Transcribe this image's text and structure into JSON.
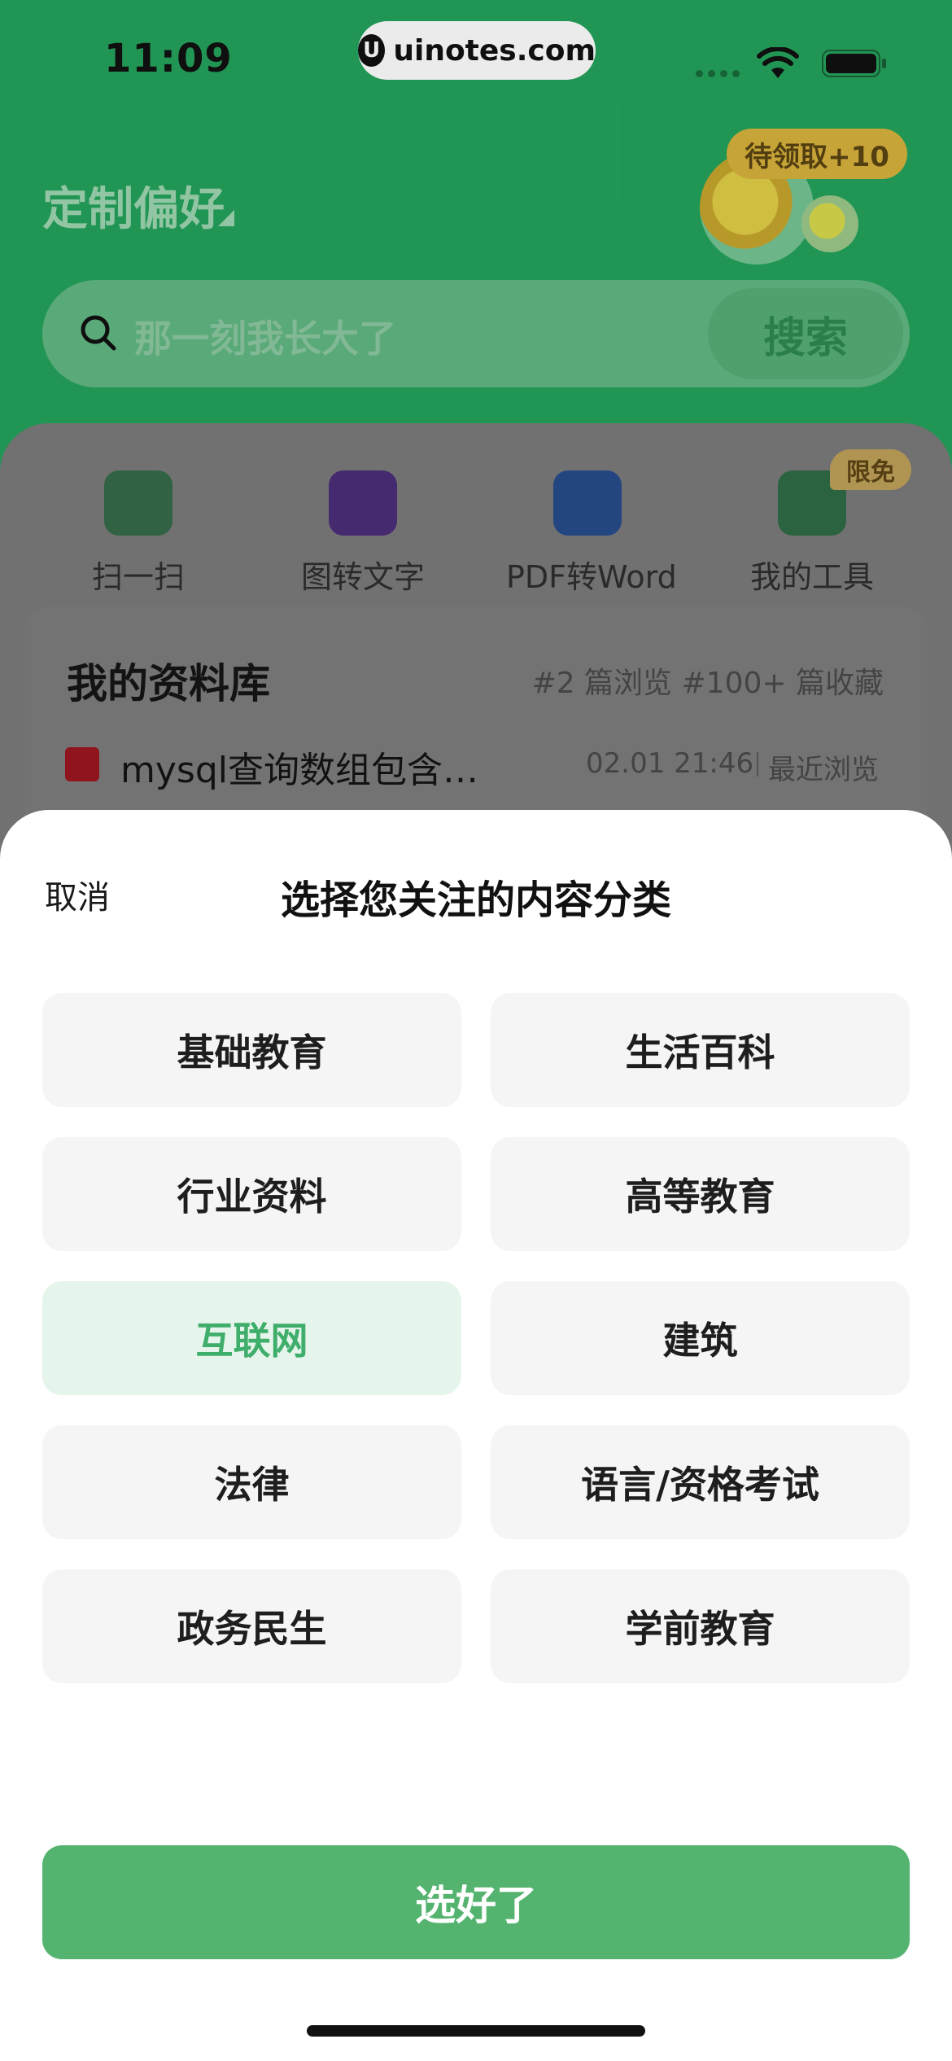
{
  "status_bar": {
    "time": "11:09",
    "watermark": "uinotes.com"
  },
  "header": {
    "title": "定制偏好",
    "reward_badge": "待领取+10"
  },
  "search": {
    "placeholder": "那一刻我长大了",
    "button": "搜索"
  },
  "tools": [
    {
      "label": "扫一扫",
      "icon": "scan-icon"
    },
    {
      "label": "图转文字",
      "icon": "image-to-text-icon"
    },
    {
      "label": "PDF转Word",
      "icon": "pdf-to-word-icon"
    },
    {
      "label": "我的工具",
      "icon": "toolbox-icon",
      "badge": "限免"
    }
  ],
  "library": {
    "title": "我的资料库",
    "stats": "#2 篇浏览 #100+ 篇收藏",
    "recent": {
      "name": "mysql查询数组包含…",
      "time": "02.01  21:46",
      "status": "最近浏览"
    }
  },
  "sheet": {
    "cancel": "取消",
    "title": "选择您关注的内容分类",
    "options": [
      {
        "label": "基础教育",
        "selected": false
      },
      {
        "label": "生活百科",
        "selected": false
      },
      {
        "label": "行业资料",
        "selected": false
      },
      {
        "label": "高等教育",
        "selected": false
      },
      {
        "label": "互联网",
        "selected": true
      },
      {
        "label": "建筑",
        "selected": false
      },
      {
        "label": "法律",
        "selected": false
      },
      {
        "label": "语言/资格考试",
        "selected": false
      },
      {
        "label": "政务民生",
        "selected": false
      },
      {
        "label": "学前教育",
        "selected": false
      }
    ],
    "confirm": "选好了"
  },
  "colors": {
    "primary": "#54b46f",
    "selected_bg": "#e6f5ec",
    "selected_text": "#3fae6b",
    "header_bg": "#24a35c"
  }
}
